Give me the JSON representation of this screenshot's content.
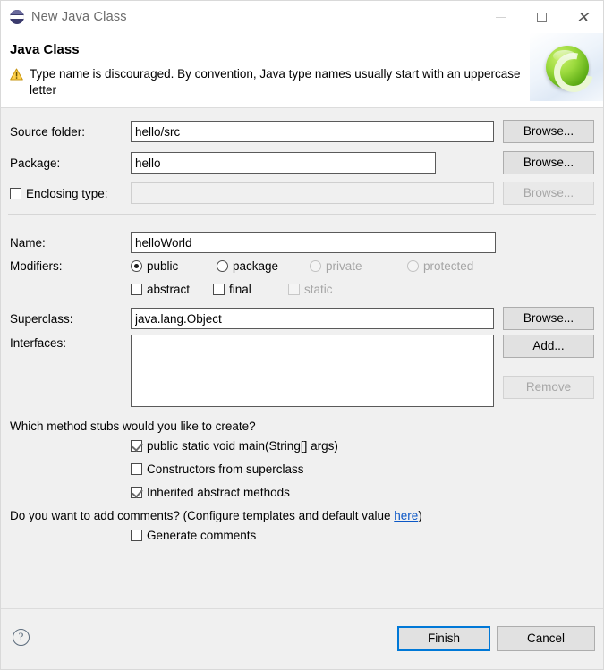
{
  "window": {
    "title": "New Java Class",
    "icon": "java-class-icon",
    "controls": {
      "minimize": "—",
      "maximize": "□",
      "close": "✕"
    }
  },
  "header": {
    "title": "Java Class",
    "status_icon": "warning-icon",
    "message": "Type name is discouraged. By convention, Java type names usually start with an uppercase letter",
    "banner_icon": "new-class-banner-icon"
  },
  "form": {
    "source_folder": {
      "label": "Source folder:",
      "value": "hello/src",
      "placeholder": "",
      "browse_label": "Browse...",
      "browse_enabled": true
    },
    "package": {
      "label": "Package:",
      "value": "hello",
      "placeholder": "",
      "browse_label": "Browse...",
      "browse_enabled": true
    },
    "enclosing_type": {
      "label": "Enclosing type:",
      "value": "",
      "placeholder": "",
      "checked": false,
      "enabled": false,
      "browse_label": "Browse...",
      "browse_enabled": false
    },
    "name": {
      "label": "Name:",
      "value": "helloWorld",
      "placeholder": ""
    },
    "modifiers": {
      "label": "Modifiers:",
      "access": [
        {
          "label": "public",
          "selected": true,
          "enabled": true
        },
        {
          "label": "package",
          "selected": false,
          "enabled": true
        },
        {
          "label": "private",
          "selected": false,
          "enabled": false
        },
        {
          "label": "protected",
          "selected": false,
          "enabled": false
        }
      ],
      "flags": [
        {
          "label": "abstract",
          "checked": false,
          "enabled": true
        },
        {
          "label": "final",
          "checked": false,
          "enabled": true
        },
        {
          "label": "static",
          "checked": false,
          "enabled": false
        }
      ]
    },
    "superclass": {
      "label": "Superclass:",
      "value": "java.lang.Object",
      "placeholder": "",
      "browse_label": "Browse...",
      "browse_enabled": true
    },
    "interfaces": {
      "label": "Interfaces:",
      "items": [],
      "add_label": "Add...",
      "add_enabled": true,
      "remove_label": "Remove",
      "remove_enabled": false
    }
  },
  "stubs": {
    "question": "Which method stubs would you like to create?",
    "options": [
      {
        "label": "public static void main(String[] args)",
        "checked": true
      },
      {
        "label": "Constructors from superclass",
        "checked": false
      },
      {
        "label": "Inherited abstract methods",
        "checked": true
      }
    ]
  },
  "comments": {
    "question_prefix": "Do you want to add comments? (Configure templates and default value ",
    "link_label": "here",
    "question_suffix": ")",
    "option": {
      "label": "Generate comments",
      "checked": false
    }
  },
  "footer": {
    "help_label": "?",
    "finish_label": "Finish",
    "cancel_label": "Cancel"
  },
  "colors": {
    "accent": "#0078d7",
    "link": "#0b57c6",
    "warning": "#f5c242",
    "banner_green": "#7ac321"
  }
}
